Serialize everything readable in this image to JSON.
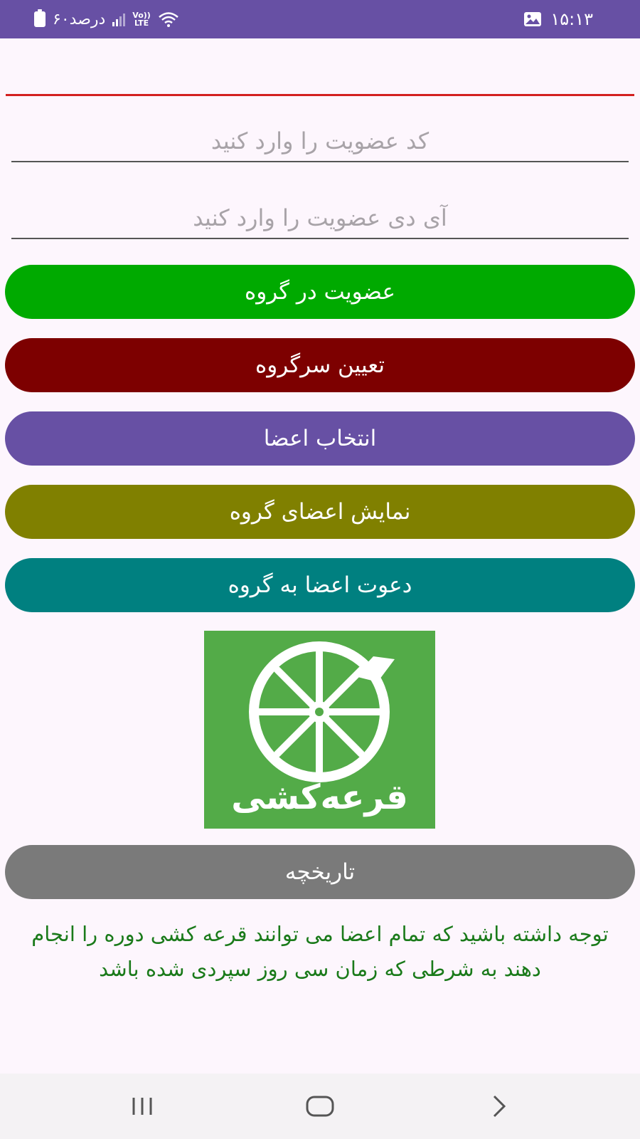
{
  "status_bar": {
    "time": "۱۵:۱۳",
    "battery_text": "۶۰درصد",
    "network_label_top": "Vo))",
    "network_label_bottom": "LTE"
  },
  "form": {
    "membership_code_placeholder": "کد عضویت را وارد کنید",
    "membership_id_placeholder": "آی دی عضویت را وارد کنید"
  },
  "buttons": {
    "join_group": "عضویت در گروه",
    "assign_leader": "تعیین سرگروه",
    "select_members": "انتخاب اعضا",
    "show_members": "نمایش اعضای گروه",
    "invite_members": "دعوت اعضا به گروه",
    "history": "تاریخچه"
  },
  "colors": {
    "status_bar": "#6750a4",
    "join_group": "#00aa00",
    "assign_leader": "#7d0000",
    "select_members": "#6750a4",
    "show_members": "#808000",
    "invite_members": "#008080",
    "history": "#7a7a7a",
    "logo_bg": "#53ab48",
    "notice_text": "#1a7a1a",
    "divider": "#d32020"
  },
  "logo": {
    "text": "قرعه‌کشی",
    "icon": "spinning-wheel-icon"
  },
  "notice": "توجه داشته باشید که تمام اعضا می توانند قرعه کشی دوره را انجام دهند به شرطی که زمان سی روز سپردی شده باشد",
  "nav": {
    "recents_icon": "recents-icon",
    "home_icon": "home-icon",
    "back_icon": "back-icon"
  }
}
